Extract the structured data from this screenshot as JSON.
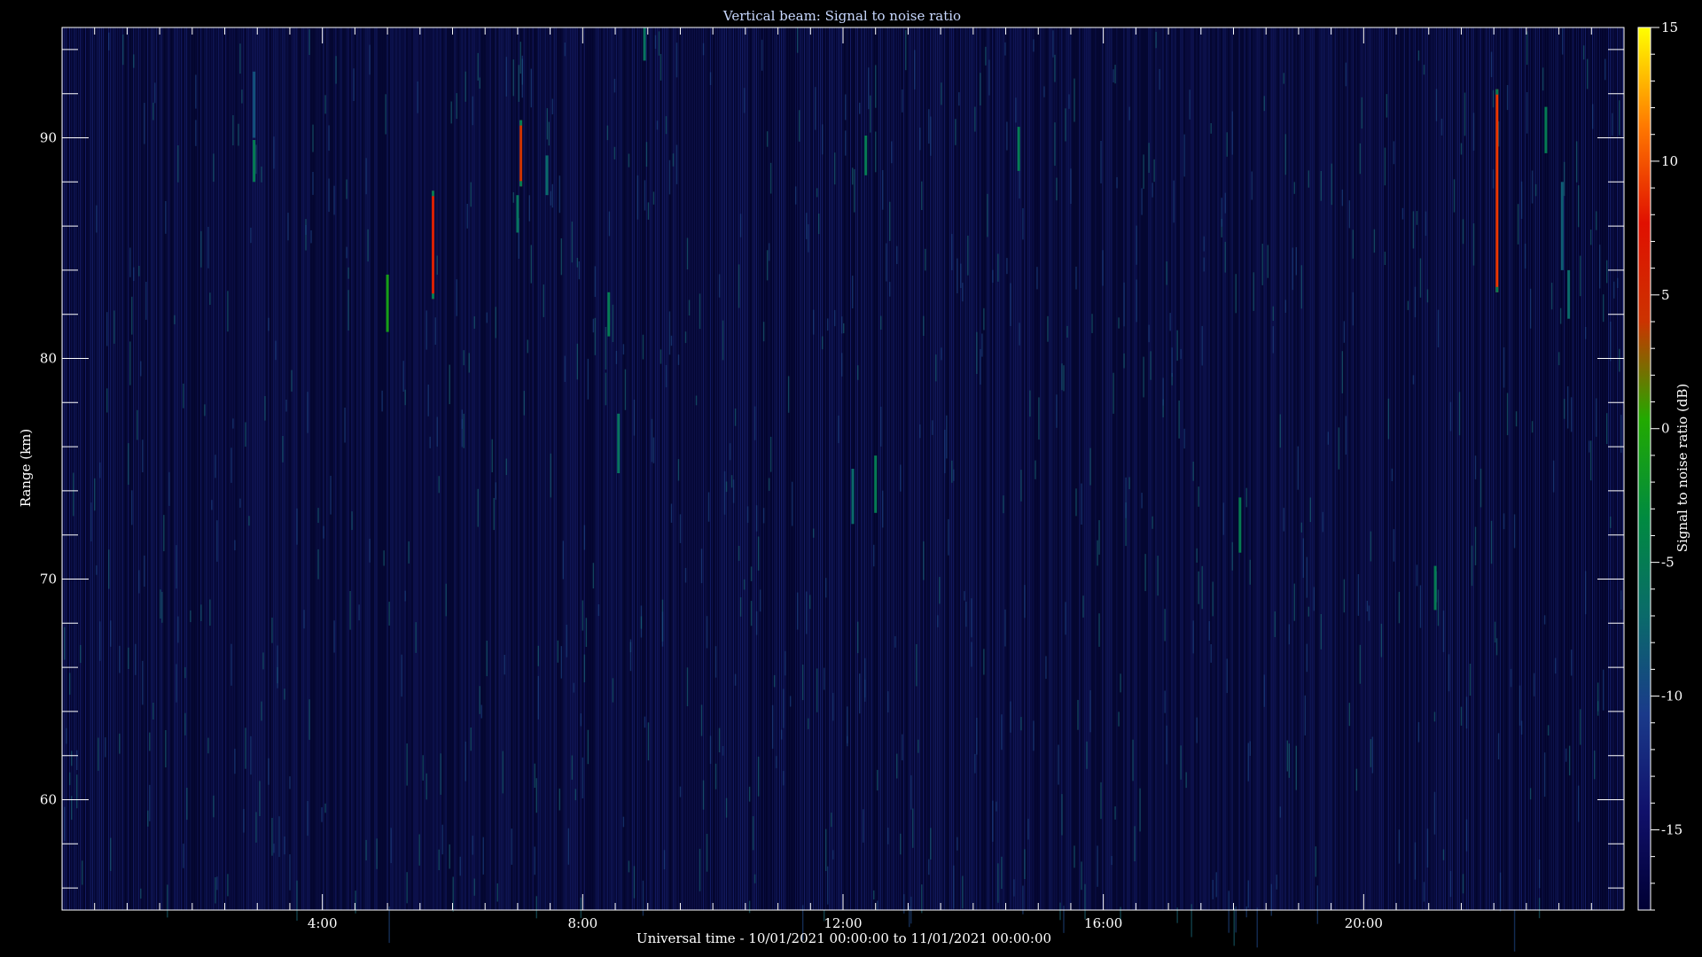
{
  "chart_data": {
    "type": "heatmap",
    "title": "Vertical beam: Signal to noise ratio",
    "xlabel": "Universal time - 10/01/2021 00:00:00 to 11/01/2021 00:00:00",
    "ylabel": "Range (km)",
    "colorbar_label": "Signal to noise ratio (dB)",
    "x_unit": "hours UT",
    "xlim": [
      0,
      24
    ],
    "ylim": [
      55,
      95
    ],
    "zlim": [
      -18,
      15
    ],
    "x_ticks": [
      {
        "value": 4,
        "label": "4:00"
      },
      {
        "value": 8,
        "label": "8:00"
      },
      {
        "value": 12,
        "label": "12:00"
      },
      {
        "value": 16,
        "label": "16:00"
      },
      {
        "value": 20,
        "label": "20:00"
      }
    ],
    "y_ticks": [
      {
        "value": 60,
        "label": "60"
      },
      {
        "value": 70,
        "label": "70"
      },
      {
        "value": 80,
        "label": "80"
      },
      {
        "value": 90,
        "label": "90"
      }
    ],
    "colorbar_ticks": [
      {
        "value": 15,
        "label": "15"
      },
      {
        "value": 10,
        "label": "10"
      },
      {
        "value": 5,
        "label": "5"
      },
      {
        "value": 0,
        "label": "0"
      },
      {
        "value": -5,
        "label": "-5"
      },
      {
        "value": -10,
        "label": "-10"
      },
      {
        "value": -15,
        "label": "-15"
      }
    ],
    "background_snr_db": -16,
    "colormap": [
      "#000033",
      "#10106a",
      "#1a3a8a",
      "#0a6a6a",
      "#008a40",
      "#22aa00",
      "#cc3300",
      "#e01000",
      "#ff7a00",
      "#ffff00"
    ],
    "events": [
      {
        "t": 2.95,
        "r0": 88.0,
        "r1": 89.9,
        "snr": -5
      },
      {
        "t": 2.95,
        "r0": 90.0,
        "r1": 93.0,
        "snr": -9
      },
      {
        "t": 5.0,
        "r0": 81.2,
        "r1": 83.8,
        "snr": -1
      },
      {
        "t": 5.7,
        "r0": 82.7,
        "r1": 87.6,
        "snr": 6
      },
      {
        "t": 7.05,
        "r0": 87.8,
        "r1": 90.8,
        "snr": 4
      },
      {
        "t": 7.0,
        "r0": 85.7,
        "r1": 87.4,
        "snr": -6
      },
      {
        "t": 7.45,
        "r0": 87.4,
        "r1": 89.2,
        "snr": -7
      },
      {
        "t": 8.4,
        "r0": 81.0,
        "r1": 83.0,
        "snr": -5
      },
      {
        "t": 8.55,
        "r0": 74.8,
        "r1": 77.5,
        "snr": -6
      },
      {
        "t": 8.95,
        "r0": 93.5,
        "r1": 95.0,
        "snr": -6
      },
      {
        "t": 12.35,
        "r0": 88.3,
        "r1": 90.1,
        "snr": -5
      },
      {
        "t": 12.15,
        "r0": 72.5,
        "r1": 75.0,
        "snr": -7
      },
      {
        "t": 12.5,
        "r0": 73.0,
        "r1": 75.6,
        "snr": -5
      },
      {
        "t": 14.7,
        "r0": 88.5,
        "r1": 90.5,
        "snr": -5
      },
      {
        "t": 18.1,
        "r0": 71.2,
        "r1": 73.7,
        "snr": -5
      },
      {
        "t": 21.1,
        "r0": 68.6,
        "r1": 70.6,
        "snr": -5
      },
      {
        "t": 22.05,
        "r0": 83.0,
        "r1": 92.2,
        "snr": 9
      },
      {
        "t": 22.8,
        "r0": 89.3,
        "r1": 91.4,
        "snr": -5
      },
      {
        "t": 23.05,
        "r0": 84.0,
        "r1": 88.0,
        "snr": -8
      },
      {
        "t": 23.15,
        "r0": 81.8,
        "r1": 84.0,
        "snr": -7
      }
    ]
  }
}
